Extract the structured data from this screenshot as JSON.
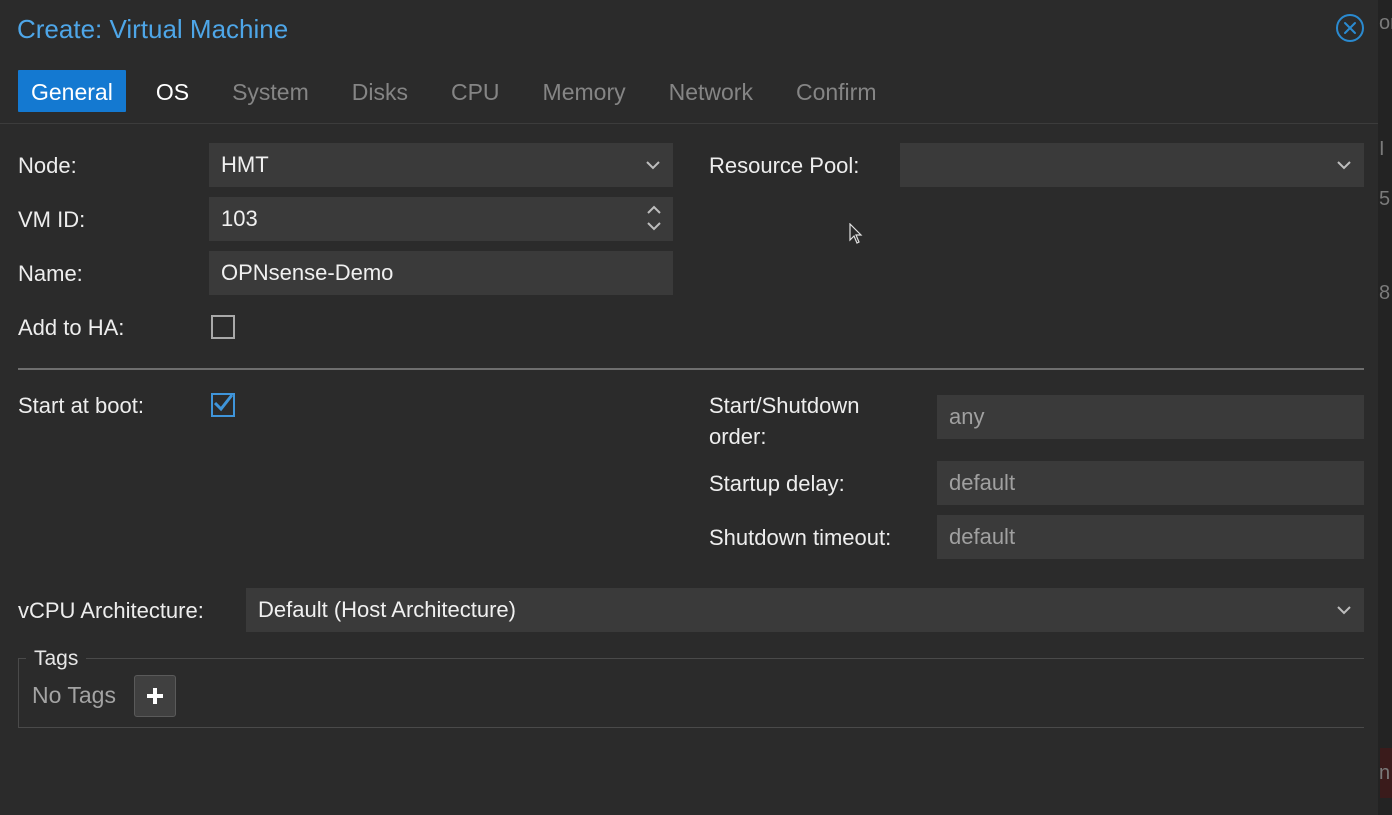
{
  "dialog": {
    "title": "Create: Virtual Machine"
  },
  "tabs": [
    {
      "label": "General",
      "state": "active"
    },
    {
      "label": "OS",
      "state": "enabled"
    },
    {
      "label": "System",
      "state": "disabled"
    },
    {
      "label": "Disks",
      "state": "disabled"
    },
    {
      "label": "CPU",
      "state": "disabled"
    },
    {
      "label": "Memory",
      "state": "disabled"
    },
    {
      "label": "Network",
      "state": "disabled"
    },
    {
      "label": "Confirm",
      "state": "disabled"
    }
  ],
  "general": {
    "node_label": "Node:",
    "node_value": "HMT",
    "vmid_label": "VM ID:",
    "vmid_value": "103",
    "name_label": "Name:",
    "name_value": "OPNsense-Demo",
    "ha_label": "Add to HA:",
    "ha_checked": false,
    "pool_label": "Resource Pool:",
    "pool_value": ""
  },
  "boot": {
    "start_label": "Start at boot:",
    "start_checked": true,
    "order_label_line1": "Start/Shutdown",
    "order_label_line2": "order:",
    "order_placeholder": "any",
    "delay_label": "Startup delay:",
    "delay_placeholder": "default",
    "timeout_label": "Shutdown timeout:",
    "timeout_placeholder": "default"
  },
  "arch": {
    "label": "vCPU Architecture:",
    "value": "Default (Host Architecture)"
  },
  "tags": {
    "legend": "Tags",
    "empty_text": "No Tags"
  },
  "background_fragments": [
    "or",
    "I",
    "5",
    "8",
    "n"
  ],
  "colors": {
    "accent": "#1479d1",
    "title": "#4ea6e8",
    "dialog_bg": "#2b2b2b",
    "field_bg": "#3a3a3a"
  },
  "icons": {
    "close": "close-circle-icon",
    "dropdown": "chevron-down-icon",
    "spinner": "spinner-arrows-icon",
    "checkmark": "checkmark-icon",
    "add": "plus-icon",
    "cursor": "mouse-pointer-icon"
  }
}
